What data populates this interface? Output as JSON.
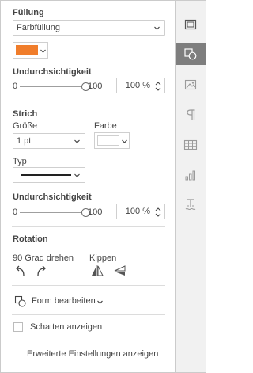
{
  "fill": {
    "title": "Füllung",
    "type_value": "Farbfüllung",
    "color": "#f07d2b",
    "opacity_title": "Undurchsichtigkeit",
    "opacity_min": "0",
    "opacity_max": "100",
    "opacity_value": "100 %",
    "opacity_level": 1.0
  },
  "stroke": {
    "title": "Strich",
    "size_label": "Größe",
    "size_value": "1 pt",
    "color_label": "Farbe",
    "color": "#ffffff",
    "type_label": "Typ",
    "opacity_title": "Undurchsichtigkeit",
    "opacity_min": "0",
    "opacity_max": "100",
    "opacity_value": "100 %",
    "opacity_level": 1.0
  },
  "rotation": {
    "title": "Rotation",
    "rotate_label": "90 Grad drehen",
    "flip_label": "Kippen"
  },
  "edit_shape_label": "Form bearbeiten",
  "shadow_label": "Schatten anzeigen",
  "advanced_link": "Erweiterte Einstellungen anzeigen",
  "sidebar_icons": [
    "slide-settings-icon",
    "shape-settings-icon",
    "image-settings-icon",
    "paragraph-settings-icon",
    "table-settings-icon",
    "chart-settings-icon",
    "text-art-settings-icon"
  ],
  "colors": {
    "accent_active": "#7e7e7e",
    "border": "#cfcfcf"
  }
}
